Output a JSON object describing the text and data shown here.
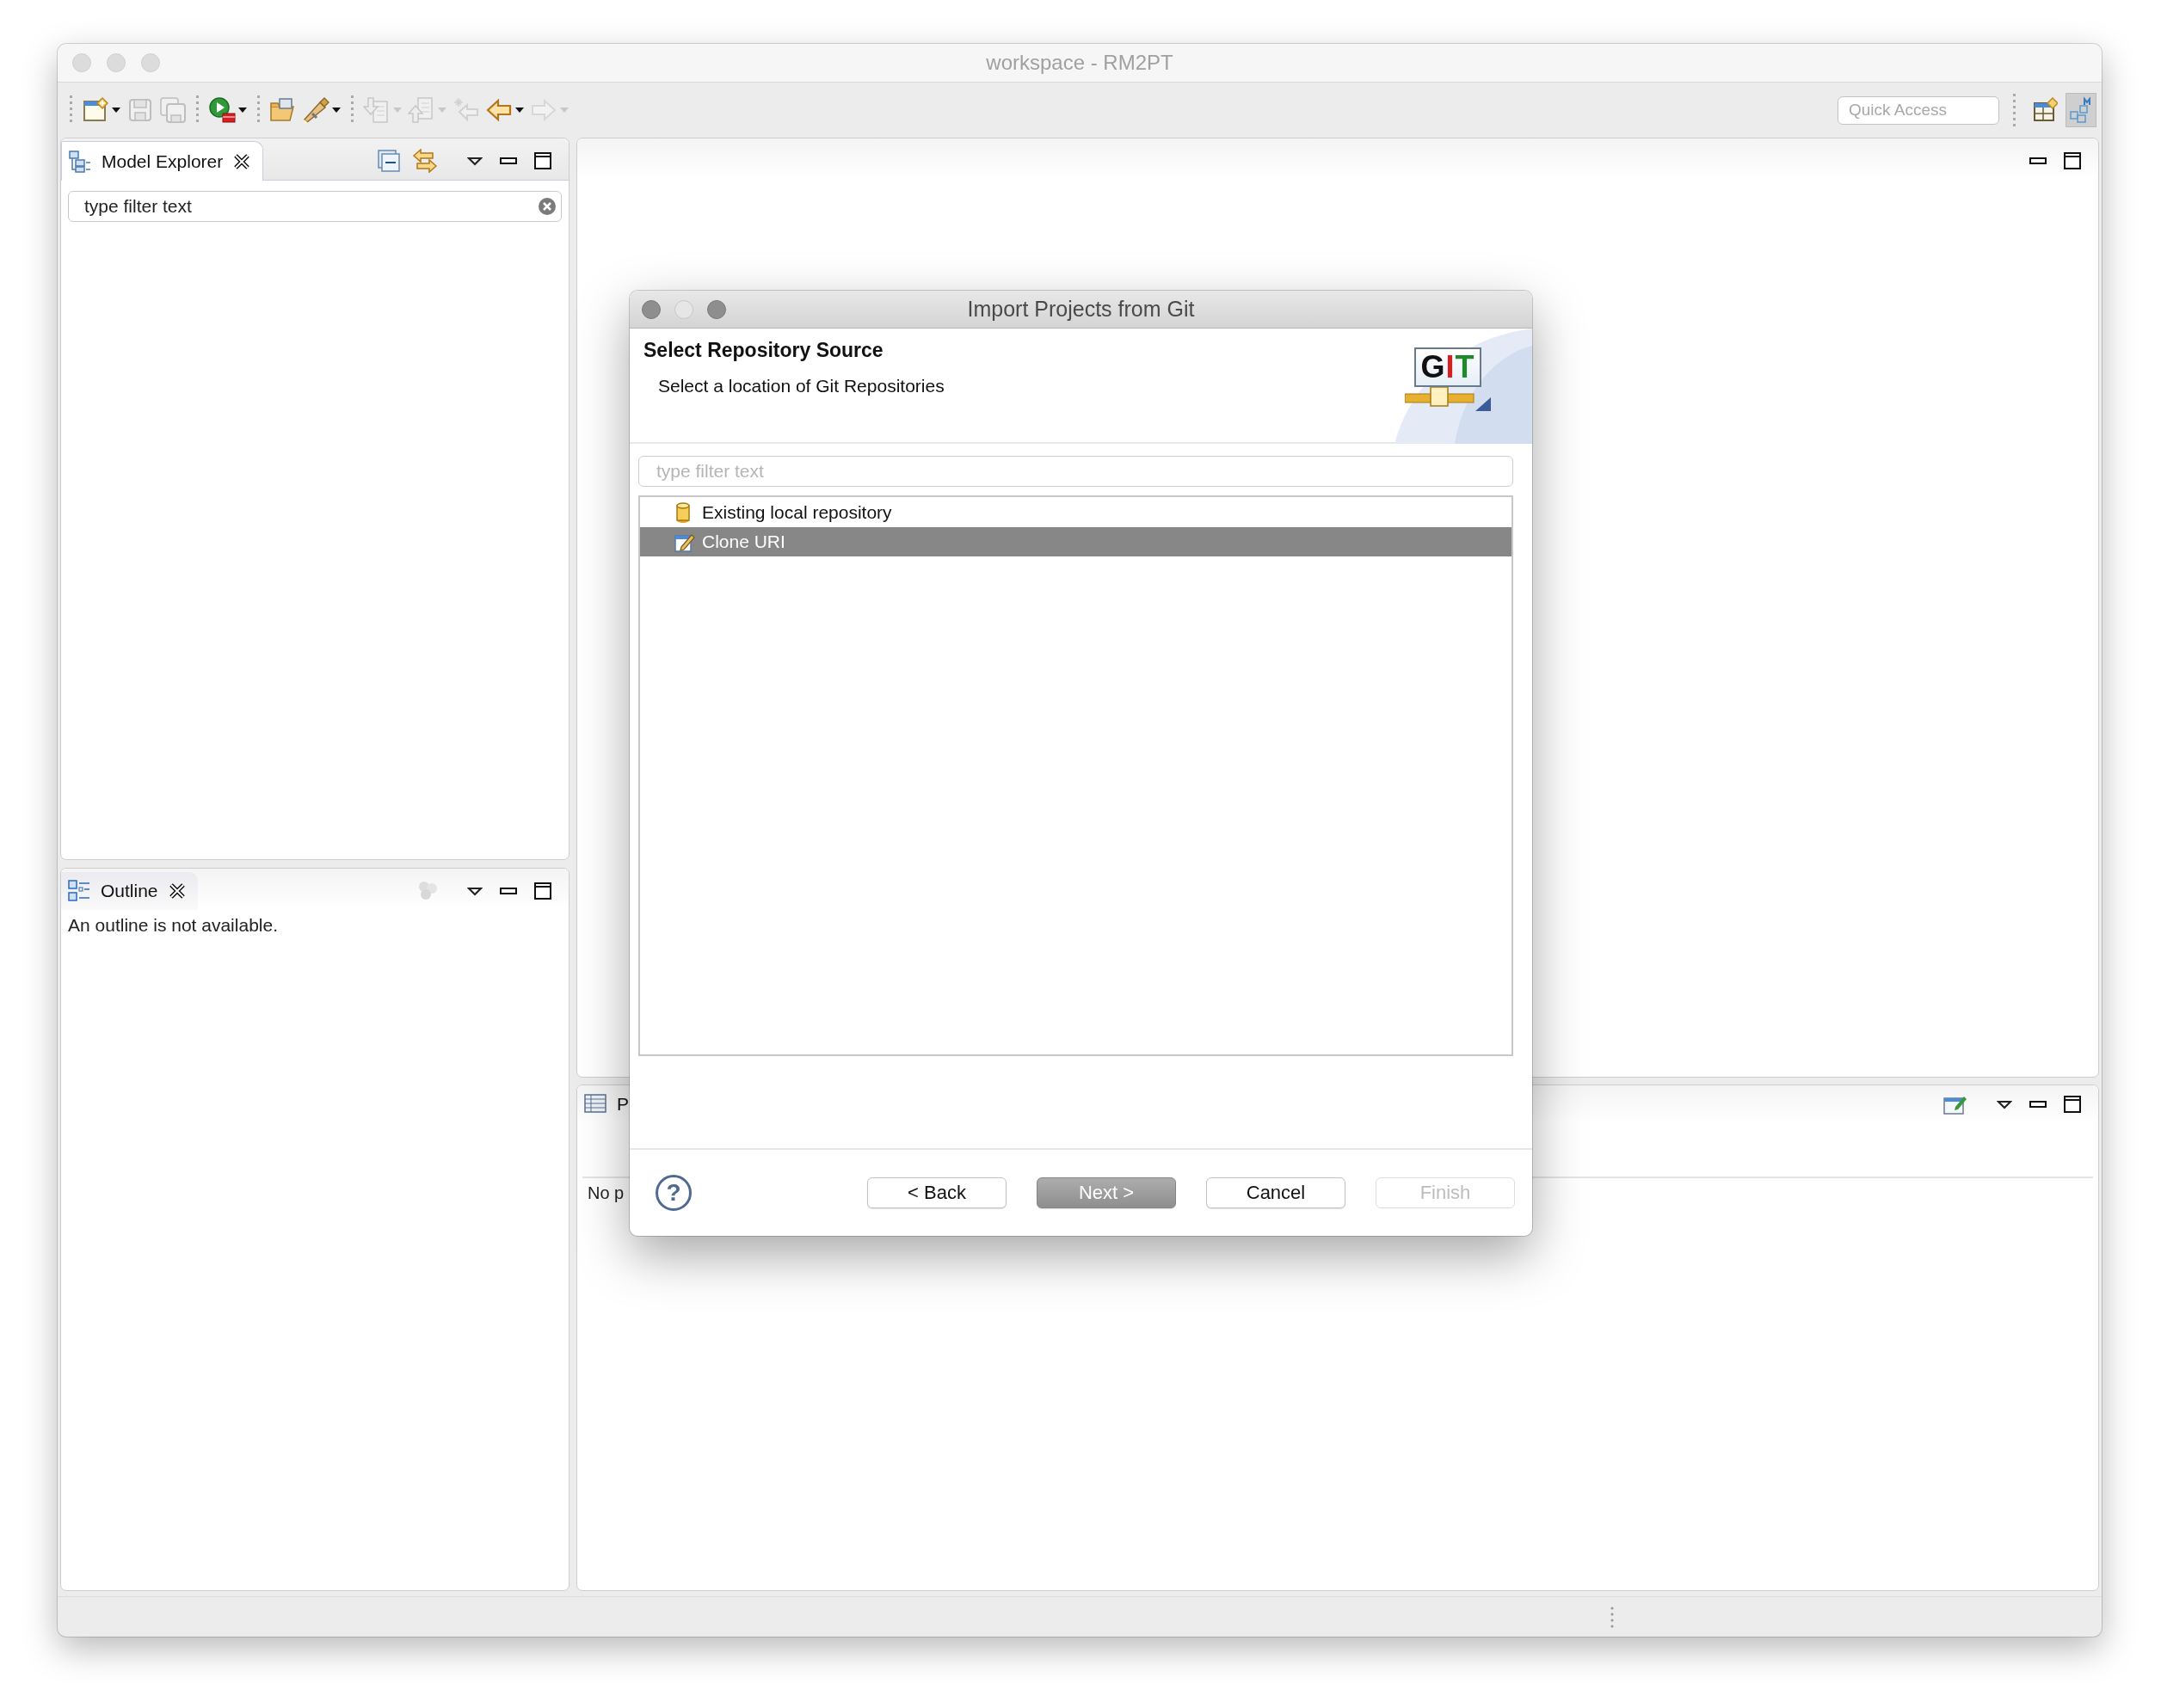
{
  "window": {
    "title": "workspace - RM2PT"
  },
  "toolbar": {
    "groups": [
      [
        {
          "kind": "new",
          "disabled": false,
          "dropdown": true
        },
        {
          "kind": "save",
          "disabled": true,
          "dropdown": false
        },
        {
          "kind": "save-all",
          "disabled": true,
          "dropdown": false
        }
      ],
      [
        {
          "kind": "run",
          "disabled": false,
          "dropdown": true
        }
      ],
      [
        {
          "kind": "open",
          "disabled": false,
          "dropdown": false
        },
        {
          "kind": "pen",
          "disabled": false,
          "dropdown": true
        }
      ],
      [
        {
          "kind": "import",
          "disabled": true,
          "dropdown": true
        },
        {
          "kind": "export",
          "disabled": true,
          "dropdown": true
        },
        {
          "kind": "last-edit",
          "disabled": true,
          "dropdown": false
        },
        {
          "kind": "back",
          "disabled": false,
          "dropdown": true
        },
        {
          "kind": "forward",
          "disabled": true,
          "dropdown": true
        }
      ]
    ]
  },
  "quick_access": {
    "placeholder": "Quick Access"
  },
  "perspectives": [
    {
      "kind": "open-perspective",
      "selected": false
    },
    {
      "kind": "modeling",
      "selected": true
    }
  ],
  "model_explorer": {
    "tab": "Model Explorer",
    "filter": {
      "value": "type filter text"
    }
  },
  "outline": {
    "tab": "Outline",
    "message": "An outline is not available."
  },
  "bottom_panel": {
    "tab": "P",
    "message": "No p"
  },
  "dialog": {
    "title": "Import Projects from Git",
    "heading": "Select Repository Source",
    "description": "Select a location of Git Repositories",
    "logo": [
      {
        "text": "G",
        "color": "#111111"
      },
      {
        "text": "I",
        "color": "#d42020"
      },
      {
        "text": "T",
        "color": "#1f8a2a"
      }
    ],
    "filter": {
      "placeholder": "type filter text"
    },
    "sources": [
      {
        "label": "Existing local repository",
        "kind": "repository",
        "selected": false
      },
      {
        "label": "Clone URI",
        "kind": "clone",
        "selected": true
      }
    ],
    "help": "?",
    "buttons": [
      {
        "label": "< Back",
        "default": false,
        "disabled": false
      },
      {
        "label": "Next >",
        "default": true,
        "disabled": false
      },
      {
        "label": "Cancel",
        "default": false,
        "disabled": false
      },
      {
        "label": "Finish",
        "default": false,
        "disabled": true
      }
    ]
  }
}
